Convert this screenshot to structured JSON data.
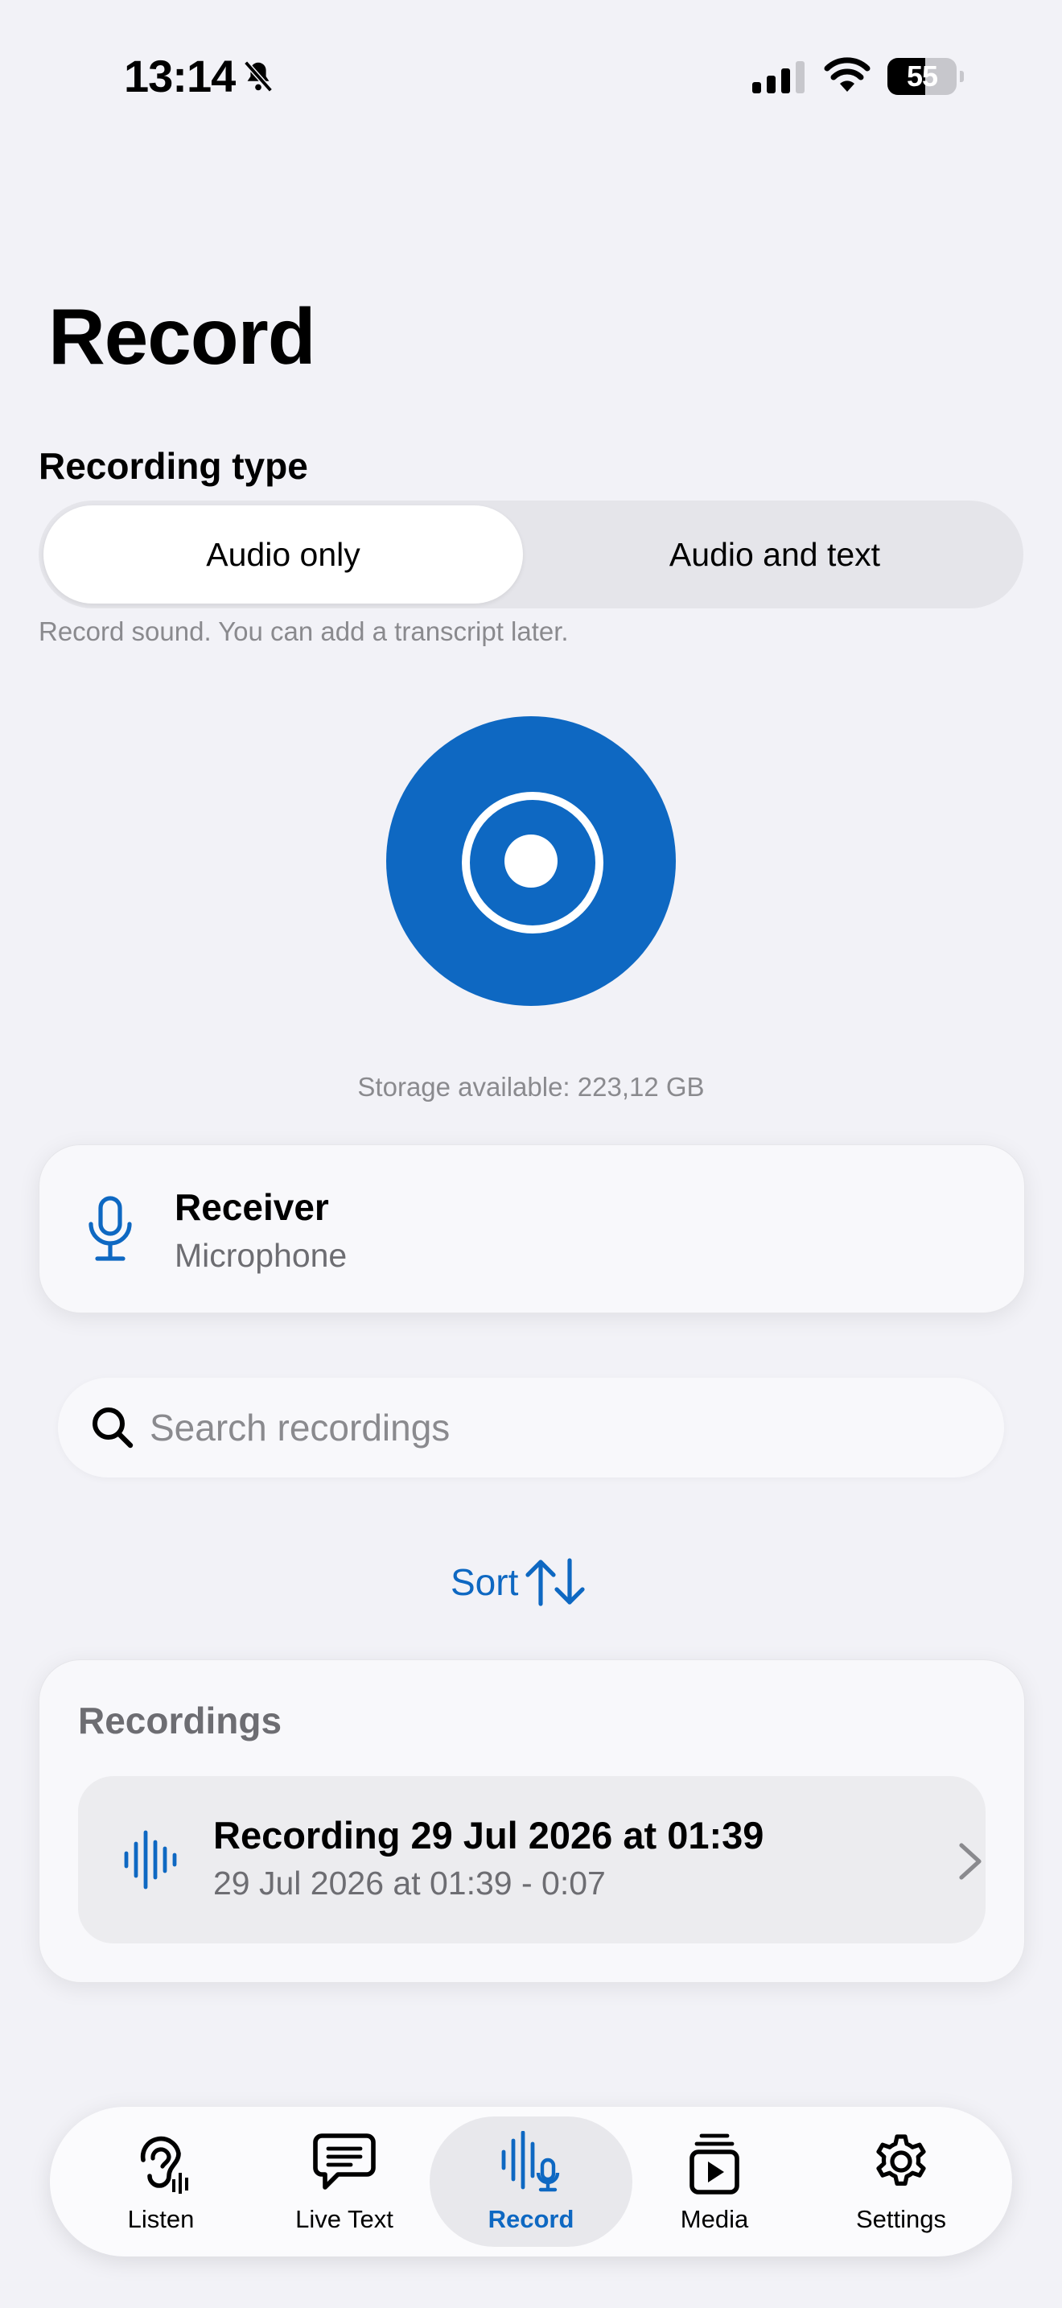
{
  "status_bar": {
    "time": "13:14",
    "battery_percent": "55",
    "battery_level": 0.55
  },
  "page": {
    "title": "Record"
  },
  "recording_type": {
    "label": "Recording type",
    "options": [
      "Audio only",
      "Audio and text"
    ],
    "selected": "Audio only",
    "helper": "Record sound. You can add a transcript later."
  },
  "storage": {
    "text": "Storage available: 223,12 GB"
  },
  "source": {
    "title": "Receiver",
    "subtitle": "Microphone"
  },
  "search": {
    "placeholder": "Search recordings"
  },
  "sort": {
    "label": "Sort"
  },
  "recordings": {
    "header": "Recordings",
    "items": [
      {
        "title": "Recording 29 Jul 2026 at 01:39",
        "subtitle": "29 Jul 2026 at 01:39 - 0:07"
      }
    ]
  },
  "tabs": [
    {
      "label": "Listen",
      "icon": "ear-icon"
    },
    {
      "label": "Live Text",
      "icon": "speech-bubble-icon"
    },
    {
      "label": "Record",
      "icon": "waveform-mic-icon"
    },
    {
      "label": "Media",
      "icon": "media-play-icon"
    },
    {
      "label": "Settings",
      "icon": "gear-icon"
    }
  ],
  "active_tab": "Record",
  "colors": {
    "accent": "#0e68c2",
    "background": "#f2f2f7"
  }
}
